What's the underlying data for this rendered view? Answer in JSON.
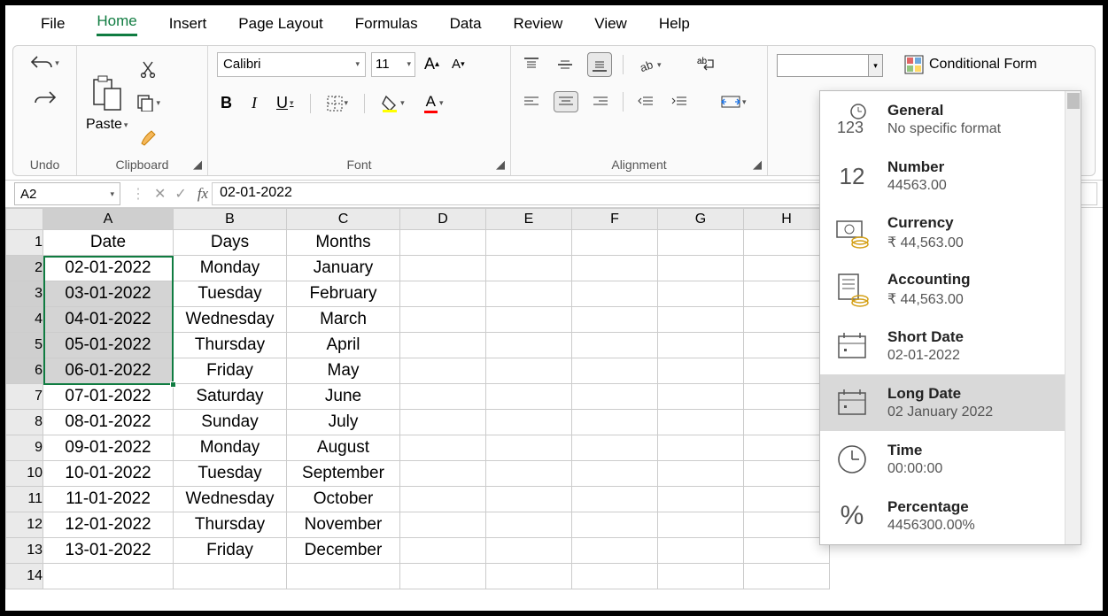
{
  "menu": {
    "items": [
      "File",
      "Home",
      "Insert",
      "Page Layout",
      "Formulas",
      "Data",
      "Review",
      "View",
      "Help"
    ],
    "active": "Home"
  },
  "ribbon": {
    "undo_label": "Undo",
    "clipboard": {
      "label": "Clipboard",
      "paste": "Paste"
    },
    "font": {
      "label": "Font",
      "name": "Calibri",
      "size": "11",
      "bold": "B",
      "italic": "I",
      "underline": "U"
    },
    "alignment": {
      "label": "Alignment",
      "wrap": "ab"
    },
    "number": {
      "label": ""
    },
    "cond_fmt": "Conditional Form"
  },
  "namebox": "A2",
  "formula": "02-01-2022",
  "columns": [
    "A",
    "B",
    "C",
    "D",
    "E",
    "F",
    "G",
    "H"
  ],
  "headers": [
    "Date",
    "Days",
    "Months"
  ],
  "rows": [
    {
      "n": 1,
      "a": "Date",
      "b": "Days",
      "c": "Months"
    },
    {
      "n": 2,
      "a": "02-01-2022",
      "b": "Monday",
      "c": "January"
    },
    {
      "n": 3,
      "a": "03-01-2022",
      "b": "Tuesday",
      "c": "February"
    },
    {
      "n": 4,
      "a": "04-01-2022",
      "b": "Wednesday",
      "c": "March"
    },
    {
      "n": 5,
      "a": "05-01-2022",
      "b": "Thursday",
      "c": "April"
    },
    {
      "n": 6,
      "a": "06-01-2022",
      "b": "Friday",
      "c": "May"
    },
    {
      "n": 7,
      "a": "07-01-2022",
      "b": "Saturday",
      "c": "June"
    },
    {
      "n": 8,
      "a": "08-01-2022",
      "b": "Sunday",
      "c": "July"
    },
    {
      "n": 9,
      "a": "09-01-2022",
      "b": "Monday",
      "c": "August"
    },
    {
      "n": 10,
      "a": "10-01-2022",
      "b": "Tuesday",
      "c": "September"
    },
    {
      "n": 11,
      "a": "11-01-2022",
      "b": "Wednesday",
      "c": "October"
    },
    {
      "n": 12,
      "a": "12-01-2022",
      "b": "Thursday",
      "c": "November"
    },
    {
      "n": 13,
      "a": "13-01-2022",
      "b": "Friday",
      "c": "December"
    },
    {
      "n": 14,
      "a": "",
      "b": "",
      "c": ""
    }
  ],
  "selection": {
    "ref": "A2:A6"
  },
  "dropdown": {
    "items": [
      {
        "key": "general",
        "title": "General",
        "sub": "No specific format",
        "icon": "123-clock"
      },
      {
        "key": "number",
        "title": "Number",
        "sub": "44563.00",
        "icon": "12"
      },
      {
        "key": "currency",
        "title": "Currency",
        "sub": "₹ 44,563.00",
        "icon": "cash"
      },
      {
        "key": "accounting",
        "title": "Accounting",
        "sub": "₹ 44,563.00",
        "icon": "ledger"
      },
      {
        "key": "shortdate",
        "title": "Short Date",
        "sub": "02-01-2022",
        "icon": "cal"
      },
      {
        "key": "longdate",
        "title": "Long Date",
        "sub": "02 January 2022",
        "icon": "cal"
      },
      {
        "key": "time",
        "title": "Time",
        "sub": "00:00:00",
        "icon": "clock"
      },
      {
        "key": "percentage",
        "title": "Percentage",
        "sub": "4456300.00%",
        "icon": "pct"
      }
    ],
    "hover": "longdate",
    "highlight": [
      "shortdate",
      "longdate"
    ]
  }
}
